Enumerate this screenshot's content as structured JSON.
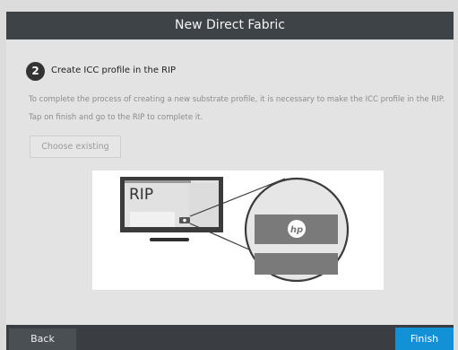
{
  "window": {
    "title": "New Direct Fabric"
  },
  "step": {
    "number": "2",
    "title": "Create ICC profile in the RIP"
  },
  "description": {
    "line1": "To complete the process of creating a new substrate profile, it is necessary to make the ICC profile in the RIP.",
    "line2": "Tap on finish and go to the RIP to complete it."
  },
  "buttons": {
    "choose_existing": "Choose existing",
    "back": "Back",
    "finish": "Finish"
  },
  "illustration": {
    "screen_label": "RIP",
    "logo_text": "hp"
  },
  "colors": {
    "title_bar": "#3e4347",
    "accent": "#1291d6"
  }
}
